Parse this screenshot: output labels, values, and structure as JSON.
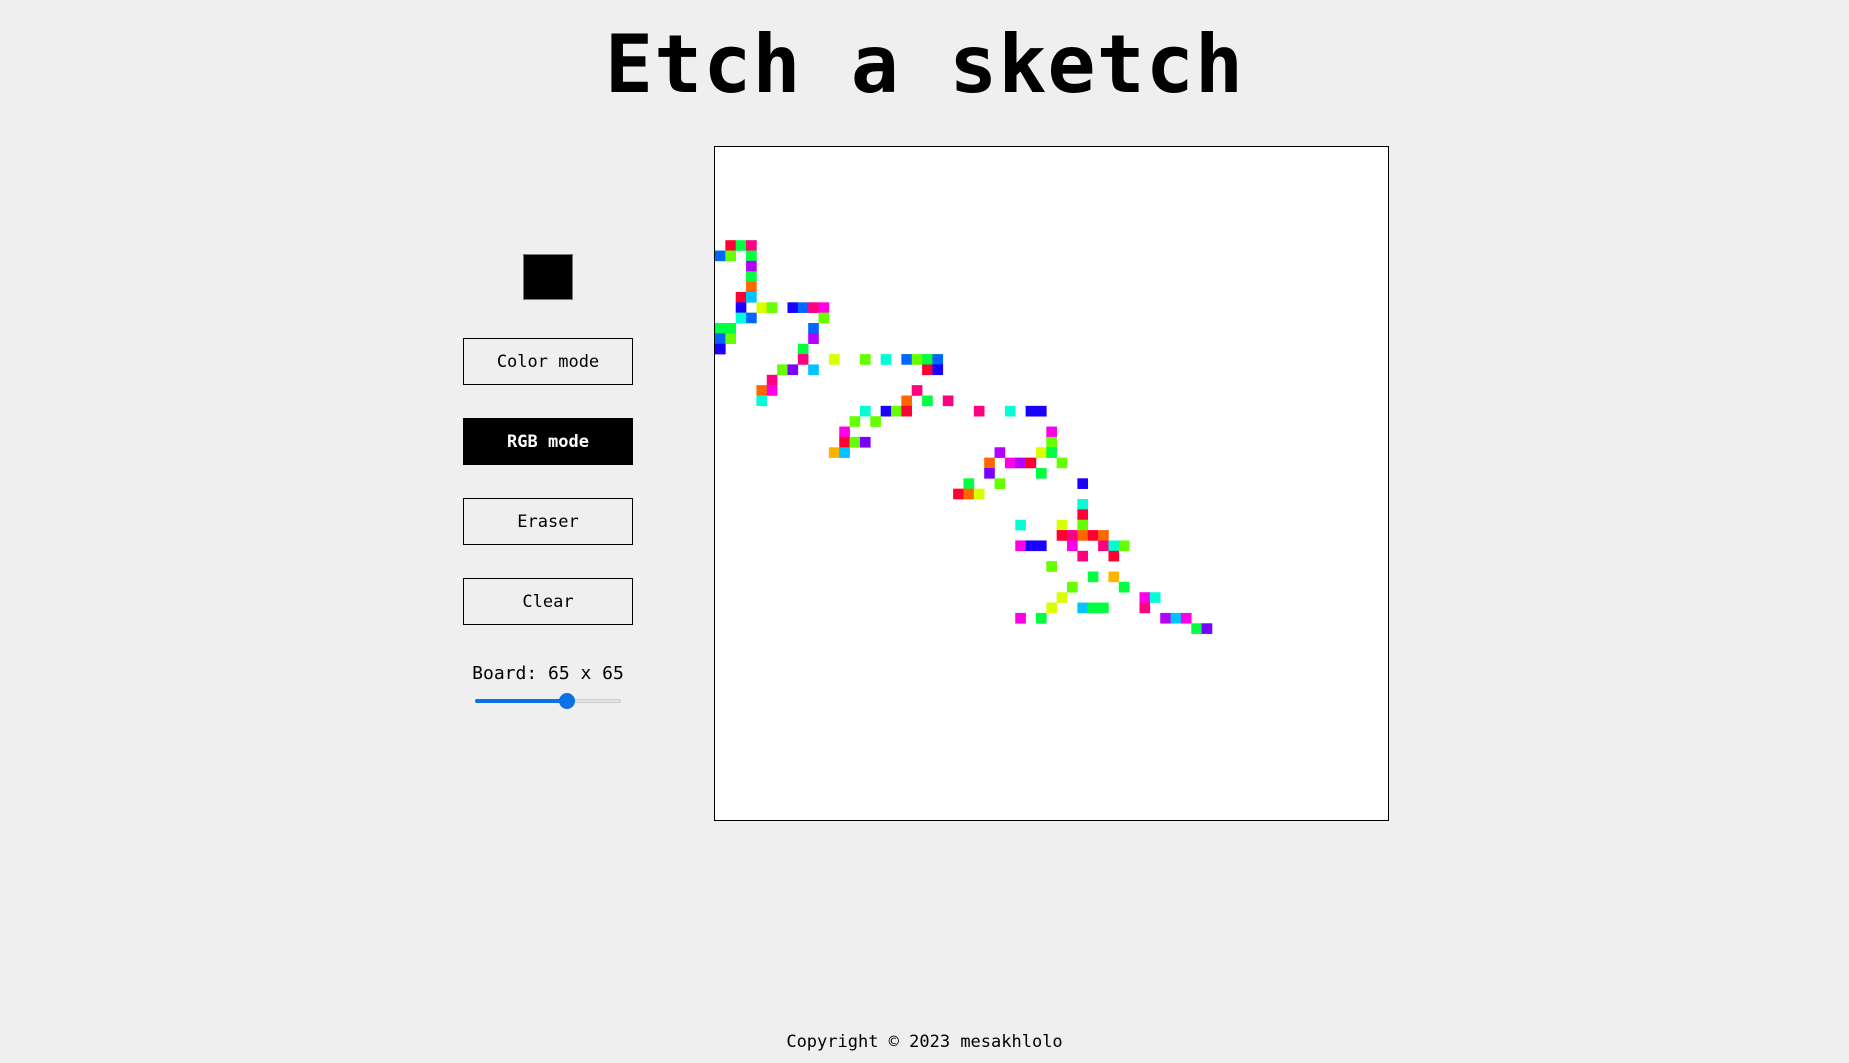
{
  "header": {
    "title": "Etch a sketch"
  },
  "controls": {
    "current_color": "#000000",
    "buttons": [
      {
        "label": "Color mode",
        "active": false
      },
      {
        "label": "RGB mode",
        "active": true
      },
      {
        "label": "Eraser",
        "active": false
      },
      {
        "label": "Clear",
        "active": false
      }
    ],
    "board_label": "Board: 65 x 65",
    "grid_size": 65,
    "slider_fraction": 0.63
  },
  "board": {
    "background": "#ffffff",
    "palette": [
      "#ff0033",
      "#ff0080",
      "#ff00e6",
      "#b300ff",
      "#7a00ff",
      "#1a00ff",
      "#0066ff",
      "#00c3ff",
      "#00ffd5",
      "#00ff40",
      "#66ff00",
      "#d9ff00",
      "#ffb300",
      "#ff6600"
    ],
    "cells": [
      [
        1,
        9,
        0
      ],
      [
        2,
        9,
        9
      ],
      [
        3,
        9,
        1
      ],
      [
        0,
        10,
        6
      ],
      [
        1,
        10,
        10
      ],
      [
        3,
        10,
        9
      ],
      [
        3,
        11,
        3
      ],
      [
        3,
        12,
        9
      ],
      [
        3,
        13,
        13
      ],
      [
        2,
        14,
        0
      ],
      [
        3,
        14,
        7
      ],
      [
        2,
        15,
        5
      ],
      [
        4,
        15,
        11
      ],
      [
        5,
        15,
        10
      ],
      [
        7,
        15,
        5
      ],
      [
        8,
        15,
        6
      ],
      [
        9,
        15,
        1
      ],
      [
        10,
        15,
        2
      ],
      [
        2,
        16,
        8
      ],
      [
        3,
        16,
        6
      ],
      [
        10,
        16,
        10
      ],
      [
        0,
        17,
        9
      ],
      [
        1,
        17,
        9
      ],
      [
        9,
        17,
        6
      ],
      [
        0,
        18,
        6
      ],
      [
        1,
        18,
        10
      ],
      [
        9,
        18,
        3
      ],
      [
        0,
        19,
        5
      ],
      [
        8,
        19,
        9
      ],
      [
        8,
        20,
        1
      ],
      [
        11,
        20,
        11
      ],
      [
        14,
        20,
        10
      ],
      [
        16,
        20,
        8
      ],
      [
        18,
        20,
        6
      ],
      [
        19,
        20,
        10
      ],
      [
        20,
        20,
        9
      ],
      [
        21,
        20,
        6
      ],
      [
        6,
        21,
        10
      ],
      [
        7,
        21,
        4
      ],
      [
        9,
        21,
        7
      ],
      [
        20,
        21,
        0
      ],
      [
        21,
        21,
        5
      ],
      [
        5,
        22,
        1
      ],
      [
        4,
        23,
        13
      ],
      [
        5,
        23,
        2
      ],
      [
        19,
        23,
        1
      ],
      [
        4,
        24,
        8
      ],
      [
        18,
        24,
        13
      ],
      [
        20,
        24,
        9
      ],
      [
        22,
        24,
        1
      ],
      [
        14,
        25,
        8
      ],
      [
        16,
        25,
        5
      ],
      [
        17,
        25,
        10
      ],
      [
        18,
        25,
        0
      ],
      [
        25,
        25,
        1
      ],
      [
        28,
        25,
        8
      ],
      [
        30,
        25,
        5
      ],
      [
        31,
        25,
        5
      ],
      [
        13,
        26,
        10
      ],
      [
        15,
        26,
        10
      ],
      [
        12,
        27,
        2
      ],
      [
        32,
        27,
        2
      ],
      [
        12,
        28,
        0
      ],
      [
        13,
        28,
        10
      ],
      [
        14,
        28,
        4
      ],
      [
        32,
        28,
        10
      ],
      [
        11,
        29,
        12
      ],
      [
        12,
        29,
        7
      ],
      [
        27,
        29,
        3
      ],
      [
        31,
        29,
        11
      ],
      [
        32,
        29,
        9
      ],
      [
        26,
        30,
        13
      ],
      [
        28,
        30,
        2
      ],
      [
        29,
        30,
        3
      ],
      [
        30,
        30,
        0
      ],
      [
        33,
        30,
        10
      ],
      [
        26,
        31,
        4
      ],
      [
        31,
        31,
        9
      ],
      [
        24,
        32,
        9
      ],
      [
        27,
        32,
        10
      ],
      [
        35,
        32,
        5
      ],
      [
        23,
        33,
        0
      ],
      [
        24,
        33,
        13
      ],
      [
        25,
        33,
        11
      ],
      [
        35,
        34,
        8
      ],
      [
        35,
        35,
        0
      ],
      [
        29,
        36,
        8
      ],
      [
        33,
        36,
        11
      ],
      [
        35,
        36,
        10
      ],
      [
        33,
        37,
        0
      ],
      [
        34,
        37,
        1
      ],
      [
        35,
        37,
        13
      ],
      [
        36,
        37,
        0
      ],
      [
        37,
        37,
        13
      ],
      [
        29,
        38,
        2
      ],
      [
        30,
        38,
        5
      ],
      [
        31,
        38,
        5
      ],
      [
        34,
        38,
        2
      ],
      [
        37,
        38,
        1
      ],
      [
        38,
        38,
        8
      ],
      [
        39,
        38,
        10
      ],
      [
        35,
        39,
        1
      ],
      [
        38,
        39,
        0
      ],
      [
        32,
        40,
        10
      ],
      [
        36,
        41,
        9
      ],
      [
        38,
        41,
        12
      ],
      [
        34,
        42,
        10
      ],
      [
        39,
        42,
        9
      ],
      [
        33,
        43,
        11
      ],
      [
        41,
        43,
        2
      ],
      [
        42,
        43,
        8
      ],
      [
        32,
        44,
        11
      ],
      [
        35,
        44,
        7
      ],
      [
        36,
        44,
        9
      ],
      [
        37,
        44,
        9
      ],
      [
        41,
        44,
        1
      ],
      [
        29,
        45,
        2
      ],
      [
        31,
        45,
        9
      ],
      [
        43,
        45,
        3
      ],
      [
        44,
        45,
        7
      ],
      [
        45,
        45,
        2
      ],
      [
        46,
        46,
        9
      ],
      [
        47,
        46,
        4
      ]
    ]
  },
  "footer": {
    "text": "Copyright © 2023 mesakhlolo"
  }
}
